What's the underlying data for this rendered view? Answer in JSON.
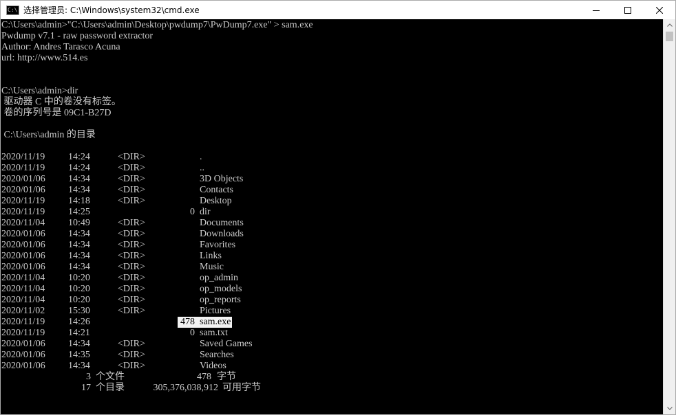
{
  "window": {
    "title": "选择管理员: C:\\Windows\\system32\\cmd.exe",
    "app_icon_text": "C:\\"
  },
  "console": {
    "header_lines": [
      "C:\\Users\\admin>\"C:\\Users\\admin\\Desktop\\pwdump7\\PwDump7.exe\" > sam.exe",
      "Pwdump v7.1 - raw password extractor",
      "Author: Andres Tarasco Acuna",
      "url: http://www.514.es",
      "",
      "",
      "C:\\Users\\admin>dir",
      " 驱动器 C 中的卷没有标签。",
      " 卷的序列号是 09C1-B27D",
      "",
      " C:\\Users\\admin 的目录",
      ""
    ],
    "listing": [
      {
        "date": "2020/11/19",
        "time": "14:24",
        "type": "<DIR>",
        "size": "",
        "name": "."
      },
      {
        "date": "2020/11/19",
        "time": "14:24",
        "type": "<DIR>",
        "size": "",
        "name": ".."
      },
      {
        "date": "2020/01/06",
        "time": "14:34",
        "type": "<DIR>",
        "size": "",
        "name": "3D Objects"
      },
      {
        "date": "2020/01/06",
        "time": "14:34",
        "type": "<DIR>",
        "size": "",
        "name": "Contacts"
      },
      {
        "date": "2020/11/19",
        "time": "14:18",
        "type": "<DIR>",
        "size": "",
        "name": "Desktop"
      },
      {
        "date": "2020/11/19",
        "time": "14:25",
        "type": "",
        "size": "0",
        "name": "dir"
      },
      {
        "date": "2020/11/04",
        "time": "10:49",
        "type": "<DIR>",
        "size": "",
        "name": "Documents"
      },
      {
        "date": "2020/01/06",
        "time": "14:34",
        "type": "<DIR>",
        "size": "",
        "name": "Downloads"
      },
      {
        "date": "2020/01/06",
        "time": "14:34",
        "type": "<DIR>",
        "size": "",
        "name": "Favorites"
      },
      {
        "date": "2020/01/06",
        "time": "14:34",
        "type": "<DIR>",
        "size": "",
        "name": "Links"
      },
      {
        "date": "2020/01/06",
        "time": "14:34",
        "type": "<DIR>",
        "size": "",
        "name": "Music"
      },
      {
        "date": "2020/11/04",
        "time": "10:20",
        "type": "<DIR>",
        "size": "",
        "name": "op_admin"
      },
      {
        "date": "2020/11/04",
        "time": "10:20",
        "type": "<DIR>",
        "size": "",
        "name": "op_models"
      },
      {
        "date": "2020/11/04",
        "time": "10:20",
        "type": "<DIR>",
        "size": "",
        "name": "op_reports"
      },
      {
        "date": "2020/11/02",
        "time": "15:30",
        "type": "<DIR>",
        "size": "",
        "name": "Pictures"
      },
      {
        "date": "2020/11/19",
        "time": "14:26",
        "type": "",
        "size": "478",
        "name": "sam.exe",
        "selected": true
      },
      {
        "date": "2020/11/19",
        "time": "14:21",
        "type": "",
        "size": "0",
        "name": "sam.txt"
      },
      {
        "date": "2020/01/06",
        "time": "14:34",
        "type": "<DIR>",
        "size": "",
        "name": "Saved Games"
      },
      {
        "date": "2020/01/06",
        "time": "14:35",
        "type": "<DIR>",
        "size": "",
        "name": "Searches"
      },
      {
        "date": "2020/01/06",
        "time": "14:34",
        "type": "<DIR>",
        "size": "",
        "name": "Videos"
      }
    ],
    "summary": {
      "files_count": "3",
      "files_label": "个文件",
      "files_bytes": "478",
      "bytes_label": "字节",
      "dirs_count": "17",
      "dirs_label": "个目录",
      "free_bytes": "305,376,038,912",
      "free_label": "可用字节"
    }
  },
  "colors": {
    "console_bg": "#000000",
    "console_fg": "#cccccc",
    "selection_bg": "#f2f2f2",
    "selection_fg": "#000000"
  }
}
